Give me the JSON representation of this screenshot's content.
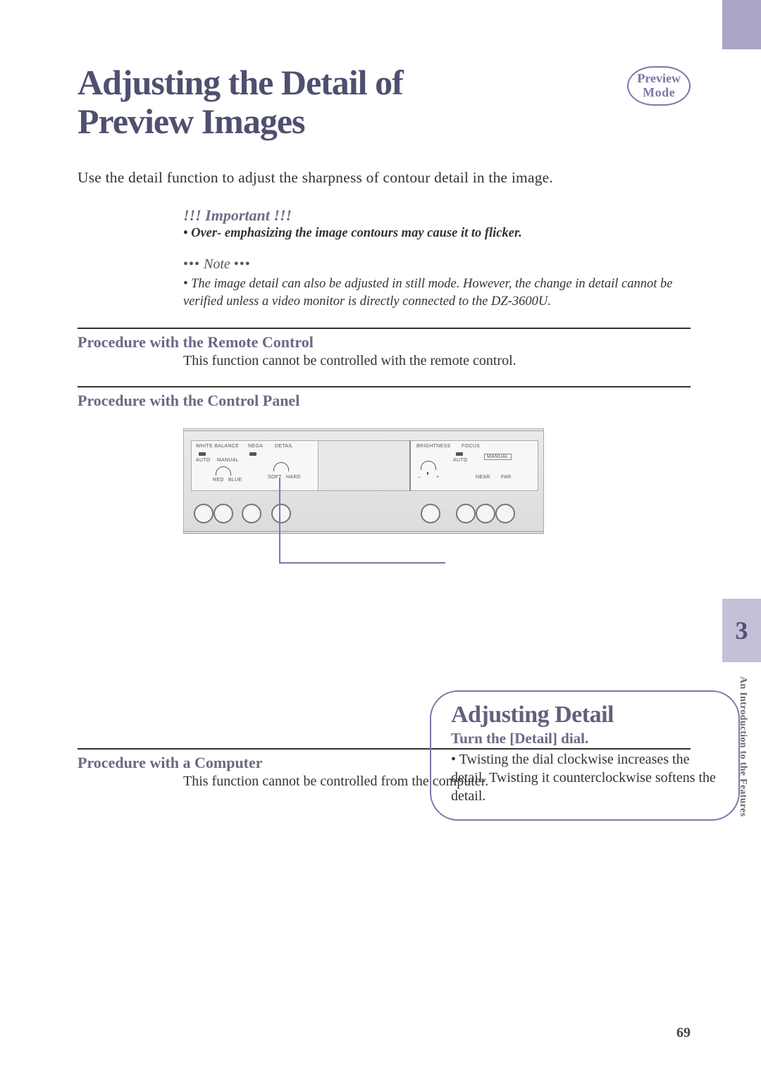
{
  "header": {
    "title_line1": "Adjusting the Detail of",
    "title_line2": "Preview Images",
    "badge_line1": "Preview",
    "badge_line2": "Mode"
  },
  "intro": "Use the detail function to adjust the sharpness of contour detail in the image.",
  "important": {
    "title": "!!! Important !!!",
    "bullet": "• Over- emphasizing the image contours may cause it to flicker."
  },
  "note": {
    "prefix": "•••",
    "label": "Note",
    "suffix": "•••",
    "body": "• The image detail can also be adjusted in still mode. However, the change in detail cannot be verified unless a video monitor is directly connected to the DZ-3600U."
  },
  "sections": {
    "remote": {
      "heading": "Procedure with the Remote Control",
      "body": "This function cannot be controlled with the remote control."
    },
    "panel": {
      "heading": "Procedure with the Control Panel"
    },
    "computer": {
      "heading": "Procedure with a Computer",
      "body": "This function cannot be controlled from the computer."
    }
  },
  "panel_labels": {
    "white_balance": "WHITE BALANCE",
    "auto": "AUTO",
    "manual": "MANUAL",
    "red": "RED",
    "blue": "BLUE",
    "nega": "NEGA",
    "detail": "DETAIL",
    "soft": "SOFT",
    "hard": "HARD",
    "brightness": "BRIGHTNESS",
    "focus": "FOCUS",
    "near": "NEAR",
    "far": "FAR",
    "minus": "–",
    "plus": "+"
  },
  "callout": {
    "title": "Adjusting Detail",
    "sub": "Turn the [Detail] dial.",
    "body": "• Twisting the dial clockwise increases the detail. Twisting it counterclockwise softens the detail."
  },
  "side": {
    "chapter": "3",
    "running_head": "An Introduction to the Features"
  },
  "page_number": "69"
}
